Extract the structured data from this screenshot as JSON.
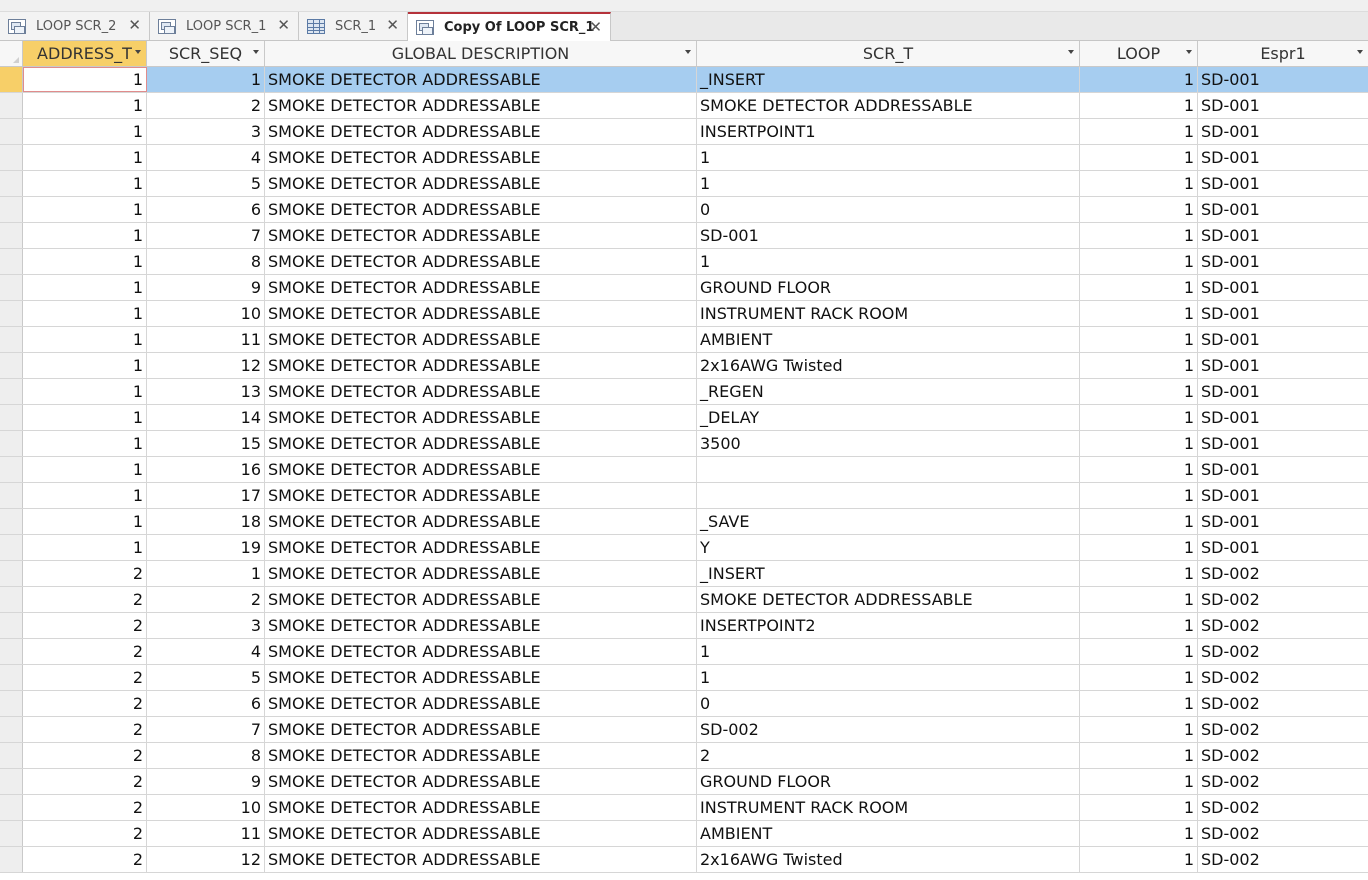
{
  "tabs": [
    {
      "label": "LOOP SCR_2",
      "icon": "query-icon",
      "active": false
    },
    {
      "label": "LOOP SCR_1",
      "icon": "query-icon",
      "active": false
    },
    {
      "label": "SCR_1",
      "icon": "table-icon",
      "active": false
    },
    {
      "label": "Copy Of LOOP SCR_1",
      "icon": "query-icon",
      "active": true
    }
  ],
  "columns": [
    "ADDRESS_T",
    "SCR_SEQ",
    "GLOBAL DESCRIPTION",
    "SCR_T",
    "LOOP",
    "Espr1"
  ],
  "rows": [
    [
      "1",
      "1",
      "SMOKE DETECTOR ADDRESSABLE",
      "_INSERT",
      "1",
      "SD-001"
    ],
    [
      "1",
      "2",
      "SMOKE DETECTOR ADDRESSABLE",
      "SMOKE DETECTOR ADDRESSABLE",
      "1",
      "SD-001"
    ],
    [
      "1",
      "3",
      "SMOKE DETECTOR ADDRESSABLE",
      "INSERTPOINT1",
      "1",
      "SD-001"
    ],
    [
      "1",
      "4",
      "SMOKE DETECTOR ADDRESSABLE",
      "1",
      "1",
      "SD-001"
    ],
    [
      "1",
      "5",
      "SMOKE DETECTOR ADDRESSABLE",
      "1",
      "1",
      "SD-001"
    ],
    [
      "1",
      "6",
      "SMOKE DETECTOR ADDRESSABLE",
      "0",
      "1",
      "SD-001"
    ],
    [
      "1",
      "7",
      "SMOKE DETECTOR ADDRESSABLE",
      "SD-001",
      "1",
      "SD-001"
    ],
    [
      "1",
      "8",
      "SMOKE DETECTOR ADDRESSABLE",
      "1",
      "1",
      "SD-001"
    ],
    [
      "1",
      "9",
      "SMOKE DETECTOR ADDRESSABLE",
      "GROUND FLOOR",
      "1",
      "SD-001"
    ],
    [
      "1",
      "10",
      "SMOKE DETECTOR ADDRESSABLE",
      "INSTRUMENT RACK ROOM",
      "1",
      "SD-001"
    ],
    [
      "1",
      "11",
      "SMOKE DETECTOR ADDRESSABLE",
      "AMBIENT",
      "1",
      "SD-001"
    ],
    [
      "1",
      "12",
      "SMOKE DETECTOR ADDRESSABLE",
      "2x16AWG Twisted",
      "1",
      "SD-001"
    ],
    [
      "1",
      "13",
      "SMOKE DETECTOR ADDRESSABLE",
      "_REGEN",
      "1",
      "SD-001"
    ],
    [
      "1",
      "14",
      "SMOKE DETECTOR ADDRESSABLE",
      "_DELAY",
      "1",
      "SD-001"
    ],
    [
      "1",
      "15",
      "SMOKE DETECTOR ADDRESSABLE",
      "3500",
      "1",
      "SD-001"
    ],
    [
      "1",
      "16",
      "SMOKE DETECTOR ADDRESSABLE",
      "",
      "1",
      "SD-001"
    ],
    [
      "1",
      "17",
      "SMOKE DETECTOR ADDRESSABLE",
      "",
      "1",
      "SD-001"
    ],
    [
      "1",
      "18",
      "SMOKE DETECTOR ADDRESSABLE",
      "_SAVE",
      "1",
      "SD-001"
    ],
    [
      "1",
      "19",
      "SMOKE DETECTOR ADDRESSABLE",
      "Y",
      "1",
      "SD-001"
    ],
    [
      "2",
      "1",
      "SMOKE DETECTOR ADDRESSABLE",
      "_INSERT",
      "1",
      "SD-002"
    ],
    [
      "2",
      "2",
      "SMOKE DETECTOR ADDRESSABLE",
      "SMOKE DETECTOR ADDRESSABLE",
      "1",
      "SD-002"
    ],
    [
      "2",
      "3",
      "SMOKE DETECTOR ADDRESSABLE",
      "INSERTPOINT2",
      "1",
      "SD-002"
    ],
    [
      "2",
      "4",
      "SMOKE DETECTOR ADDRESSABLE",
      "1",
      "1",
      "SD-002"
    ],
    [
      "2",
      "5",
      "SMOKE DETECTOR ADDRESSABLE",
      "1",
      "1",
      "SD-002"
    ],
    [
      "2",
      "6",
      "SMOKE DETECTOR ADDRESSABLE",
      "0",
      "1",
      "SD-002"
    ],
    [
      "2",
      "7",
      "SMOKE DETECTOR ADDRESSABLE",
      "SD-002",
      "1",
      "SD-002"
    ],
    [
      "2",
      "8",
      "SMOKE DETECTOR ADDRESSABLE",
      "2",
      "1",
      "SD-002"
    ],
    [
      "2",
      "9",
      "SMOKE DETECTOR ADDRESSABLE",
      "GROUND FLOOR",
      "1",
      "SD-002"
    ],
    [
      "2",
      "10",
      "SMOKE DETECTOR ADDRESSABLE",
      "INSTRUMENT RACK ROOM",
      "1",
      "SD-002"
    ],
    [
      "2",
      "11",
      "SMOKE DETECTOR ADDRESSABLE",
      "AMBIENT",
      "1",
      "SD-002"
    ],
    [
      "2",
      "12",
      "SMOKE DETECTOR ADDRESSABLE",
      "2x16AWG Twisted",
      "1",
      "SD-002"
    ]
  ],
  "colors": {
    "active_tab_accent": "#b5323a",
    "selected_row": "#a6cdf0",
    "selected_header": "#f7cf68"
  }
}
